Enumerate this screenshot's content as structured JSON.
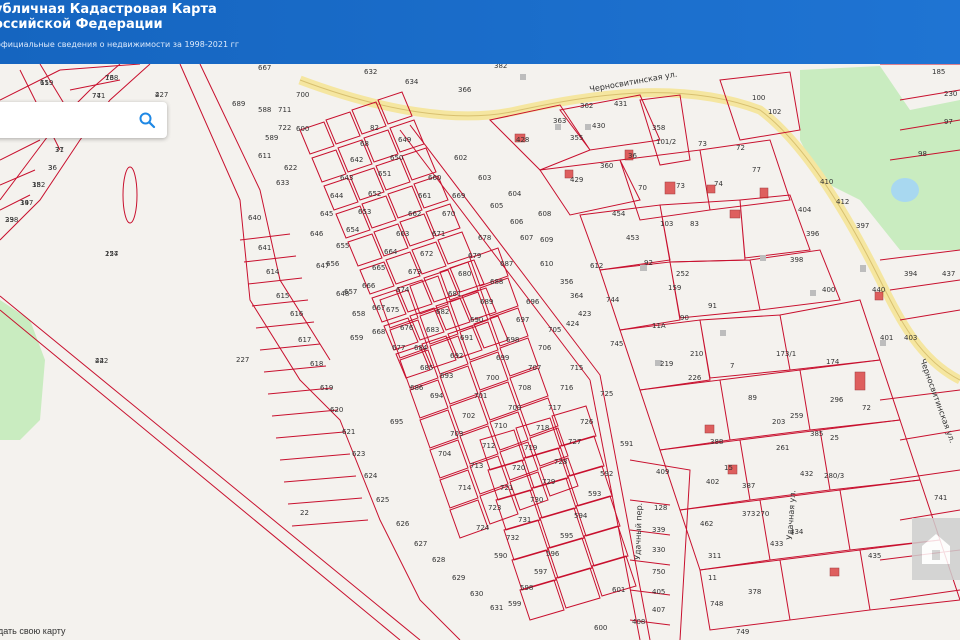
{
  "header": {
    "title_line1": "убличная Кадастровая Карта",
    "title_line2": "оссийской Федерации",
    "subtitle": "официальные сведения о недвижимости за 1998-2021 гг"
  },
  "search": {
    "icon": "search-icon"
  },
  "footer": {
    "link": "дать свою карту"
  },
  "colors": {
    "header": "#1565c0",
    "parcel_line": "#c8102e",
    "road": "#f5e9a8",
    "green": "#c9ecc0"
  },
  "streets": [
    "Черносвитинская ул.",
    "Черносвитинская ул.",
    "Удачный пер.",
    "Удачная ул."
  ],
  "parcels": [
    "65",
    "76",
    "77",
    "227",
    "37",
    "36",
    "35",
    "34",
    "33",
    "227",
    "22",
    "227",
    "22",
    "667",
    "689",
    "588",
    "700",
    "711",
    "722",
    "589",
    "600",
    "611",
    "622",
    "633",
    "640",
    "641",
    "614",
    "615",
    "616",
    "617",
    "618",
    "619",
    "620",
    "621",
    "623",
    "624",
    "625",
    "626",
    "627",
    "628",
    "629",
    "630",
    "631",
    "632",
    "634",
    "382",
    "82",
    "68",
    "642",
    "643",
    "644",
    "645",
    "646",
    "647",
    "648",
    "649",
    "650",
    "651",
    "652",
    "653",
    "654",
    "655",
    "656",
    "657",
    "658",
    "659",
    "660",
    "661",
    "662",
    "663",
    "664",
    "665",
    "666",
    "667",
    "668",
    "669",
    "670",
    "671",
    "672",
    "673",
    "674",
    "675",
    "676",
    "677",
    "678",
    "679",
    "680",
    "681",
    "682",
    "683",
    "684",
    "685",
    "686",
    "687",
    "688",
    "689",
    "690",
    "691",
    "692",
    "693",
    "694",
    "695",
    "696",
    "697",
    "698",
    "699",
    "700",
    "701",
    "702",
    "703",
    "704",
    "705",
    "706",
    "707",
    "708",
    "709",
    "710",
    "712",
    "713",
    "714",
    "715",
    "716",
    "717",
    "718",
    "719",
    "720",
    "721",
    "723",
    "724",
    "725",
    "726",
    "727",
    "728",
    "729",
    "730",
    "731",
    "732",
    "590",
    "591",
    "592",
    "593",
    "594",
    "595",
    "596",
    "597",
    "598",
    "599",
    "600",
    "601",
    "602",
    "603",
    "604",
    "605",
    "606",
    "607",
    "608",
    "609",
    "610",
    "612",
    "356",
    "364",
    "423",
    "424",
    "744",
    "745",
    "366",
    "363",
    "355",
    "362",
    "430",
    "431",
    "428",
    "429",
    "360",
    "358",
    "101/2",
    "36",
    "70",
    "73",
    "74",
    "73",
    "72",
    "100",
    "77",
    "102",
    "454",
    "103",
    "83",
    "453",
    "92",
    "252",
    "159",
    "90",
    "91",
    "11А",
    "219",
    "210",
    "226",
    "7",
    "89",
    "173/1",
    "174",
    "296",
    "72",
    "203",
    "259",
    "385",
    "25",
    "388",
    "15",
    "387",
    "261",
    "432",
    "280/3",
    "270",
    "433",
    "434",
    "435",
    "311",
    "11",
    "378",
    "748",
    "749",
    "462",
    "128",
    "339",
    "330",
    "750",
    "405",
    "407",
    "408",
    "409",
    "410",
    "412",
    "404",
    "396",
    "397",
    "398",
    "400",
    "401",
    "402",
    "373",
    "403",
    "394",
    "437",
    "440",
    "185",
    "230",
    "97",
    "98",
    "741",
    "119",
    "138",
    "741",
    "4",
    "71",
    "3",
    "182",
    "197",
    "298",
    "154",
    "442"
  ]
}
